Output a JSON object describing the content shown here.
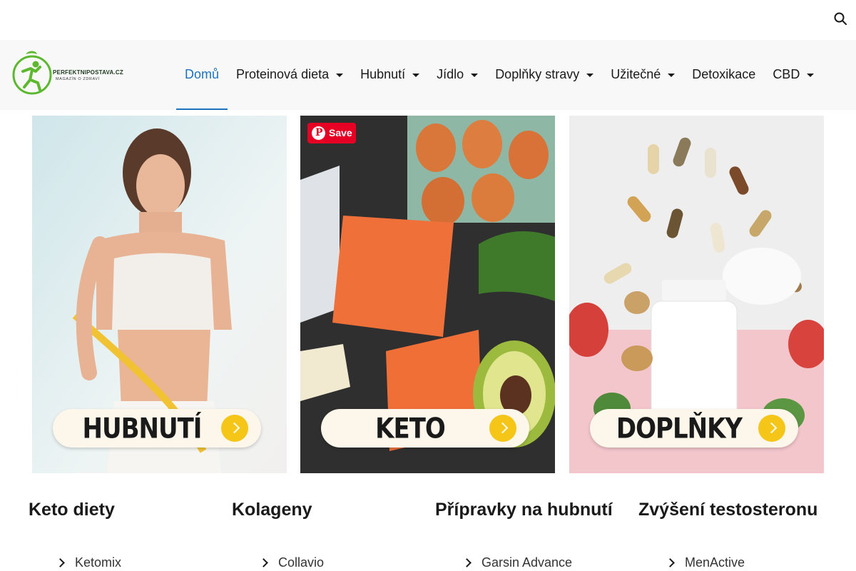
{
  "site": {
    "logo_text": "PERFEKTNIPOSTAVA.CZ",
    "logo_subtitle": "MAGAZÍN O ZDRAVÍ",
    "accent_color": "#1e73be",
    "logo_color": "#5cb82e"
  },
  "header": {
    "search_icon": "search-icon"
  },
  "menu": {
    "items": [
      {
        "label": "Domů",
        "active": true,
        "has_dropdown": false
      },
      {
        "label": "Proteinová dieta",
        "active": false,
        "has_dropdown": true
      },
      {
        "label": "Hubnutí",
        "active": false,
        "has_dropdown": true
      },
      {
        "label": "Jídlo",
        "active": false,
        "has_dropdown": true
      },
      {
        "label": "Doplňky stravy",
        "active": false,
        "has_dropdown": true
      },
      {
        "label": "Užitečné",
        "active": false,
        "has_dropdown": true
      },
      {
        "label": "Detoxikace",
        "active": false,
        "has_dropdown": false
      },
      {
        "label": "CBD",
        "active": false,
        "has_dropdown": true
      }
    ]
  },
  "tiles": [
    {
      "label": "HUBNUTÍ"
    },
    {
      "label": "KETO",
      "save_label": "Save"
    },
    {
      "label": "DOPLŇKY"
    }
  ],
  "categories": [
    {
      "title": "Keto diety",
      "links": [
        "Ketomix"
      ]
    },
    {
      "title": "Kolageny",
      "links": [
        "Collavio"
      ]
    },
    {
      "title": "Přípravky na hubnutí",
      "links": [
        "Garsin Advance"
      ]
    },
    {
      "title": "Zvýšení testosteronu",
      "links": [
        "MenActive"
      ]
    }
  ]
}
